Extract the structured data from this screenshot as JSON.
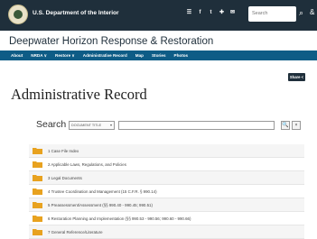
{
  "header": {
    "agency": "U.S. Department of the Interior",
    "search_placeholder": "Search",
    "social_icons": [
      "rss-icon",
      "facebook-icon",
      "twitter-icon",
      "share-icon",
      "email-icon"
    ]
  },
  "site": {
    "title": "Deepwater Horizon Response & Restoration"
  },
  "nav": {
    "items": [
      "About",
      "NRDA ∨",
      "Restore ∨",
      "Administrative Record",
      "Map",
      "Stories",
      "Photos"
    ]
  },
  "page": {
    "title": "Administrative Record",
    "share_label": "Share <"
  },
  "search": {
    "label": "Search",
    "select_value": "DOCUMENT TITLE",
    "go_label": "🔍",
    "clear_label": "×"
  },
  "records": {
    "items": [
      "1   Case File Index",
      "2   Applicable Laws, Regulations, and Policies",
      "3   Legal Documents",
      "4   Trustee Coordination and Management (15 C.F.R. § 990.14)",
      "5   Preassessment/Assessment (§§ 990.40 - 990.45; 990.51)",
      "6   Restoration Planning and Implementation (§§ 990.53 - 990.56; 990.60 - 990.66)",
      "7   General Reference/Literature"
    ]
  },
  "colors": {
    "topbar": "#1f2f3b",
    "navbar": "#0e5c86",
    "folder": "#e8a21f"
  }
}
